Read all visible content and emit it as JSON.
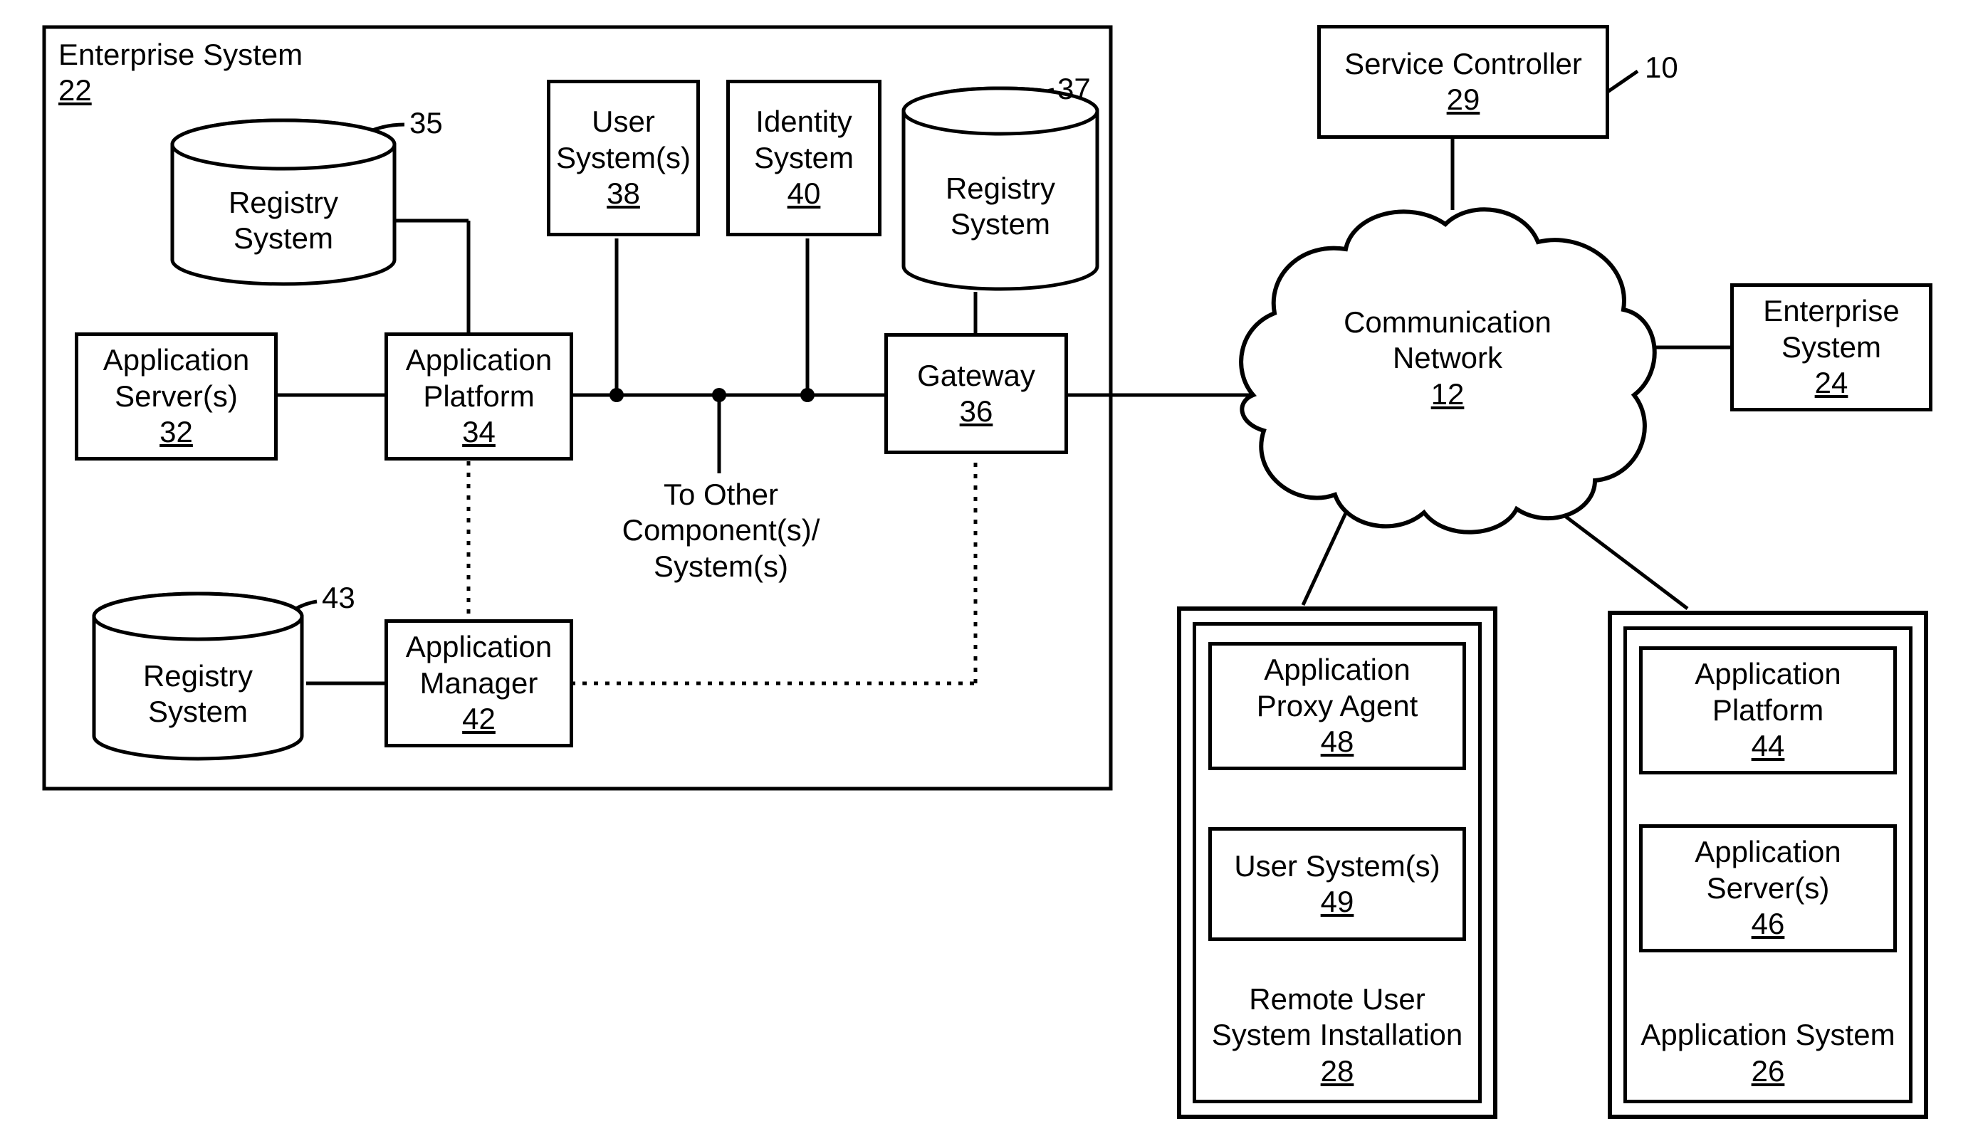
{
  "figure_ref": "10",
  "enterprise_system": {
    "title": "Enterprise System",
    "num": "22",
    "registry_35": {
      "label": "Registry\nSystem",
      "callout": "35"
    },
    "registry_37": {
      "label": "Registry\nSystem",
      "callout": "37"
    },
    "registry_43": {
      "label": "Registry\nSystem",
      "callout": "43"
    },
    "app_servers": {
      "label": "Application\nServer(s)",
      "num": "32"
    },
    "app_platform": {
      "label": "Application\nPlatform",
      "num": "34"
    },
    "user_systems": {
      "label": "User\nSystem(s)",
      "num": "38"
    },
    "identity_system": {
      "label": "Identity\nSystem",
      "num": "40"
    },
    "gateway": {
      "label": "Gateway",
      "num": "36"
    },
    "app_manager": {
      "label": "Application\nManager",
      "num": "42"
    },
    "to_other": "To Other\nComponent(s)/\nSystem(s)"
  },
  "service_controller": {
    "label": "Service Controller",
    "num": "29"
  },
  "comm_network": {
    "label": "Communication\nNetwork",
    "num": "12"
  },
  "enterprise_system_right": {
    "label": "Enterprise\nSystem",
    "num": "24"
  },
  "remote_user": {
    "title": "Remote User\nSystem Installation",
    "num": "28",
    "proxy_agent": {
      "label": "Application\nProxy Agent",
      "num": "48"
    },
    "user_systems": {
      "label": "User System(s)",
      "num": "49"
    }
  },
  "application_system": {
    "title": "Application System",
    "num": "26",
    "app_platform": {
      "label": "Application\nPlatform",
      "num": "44"
    },
    "app_servers": {
      "label": "Application\nServer(s)",
      "num": "46"
    }
  }
}
